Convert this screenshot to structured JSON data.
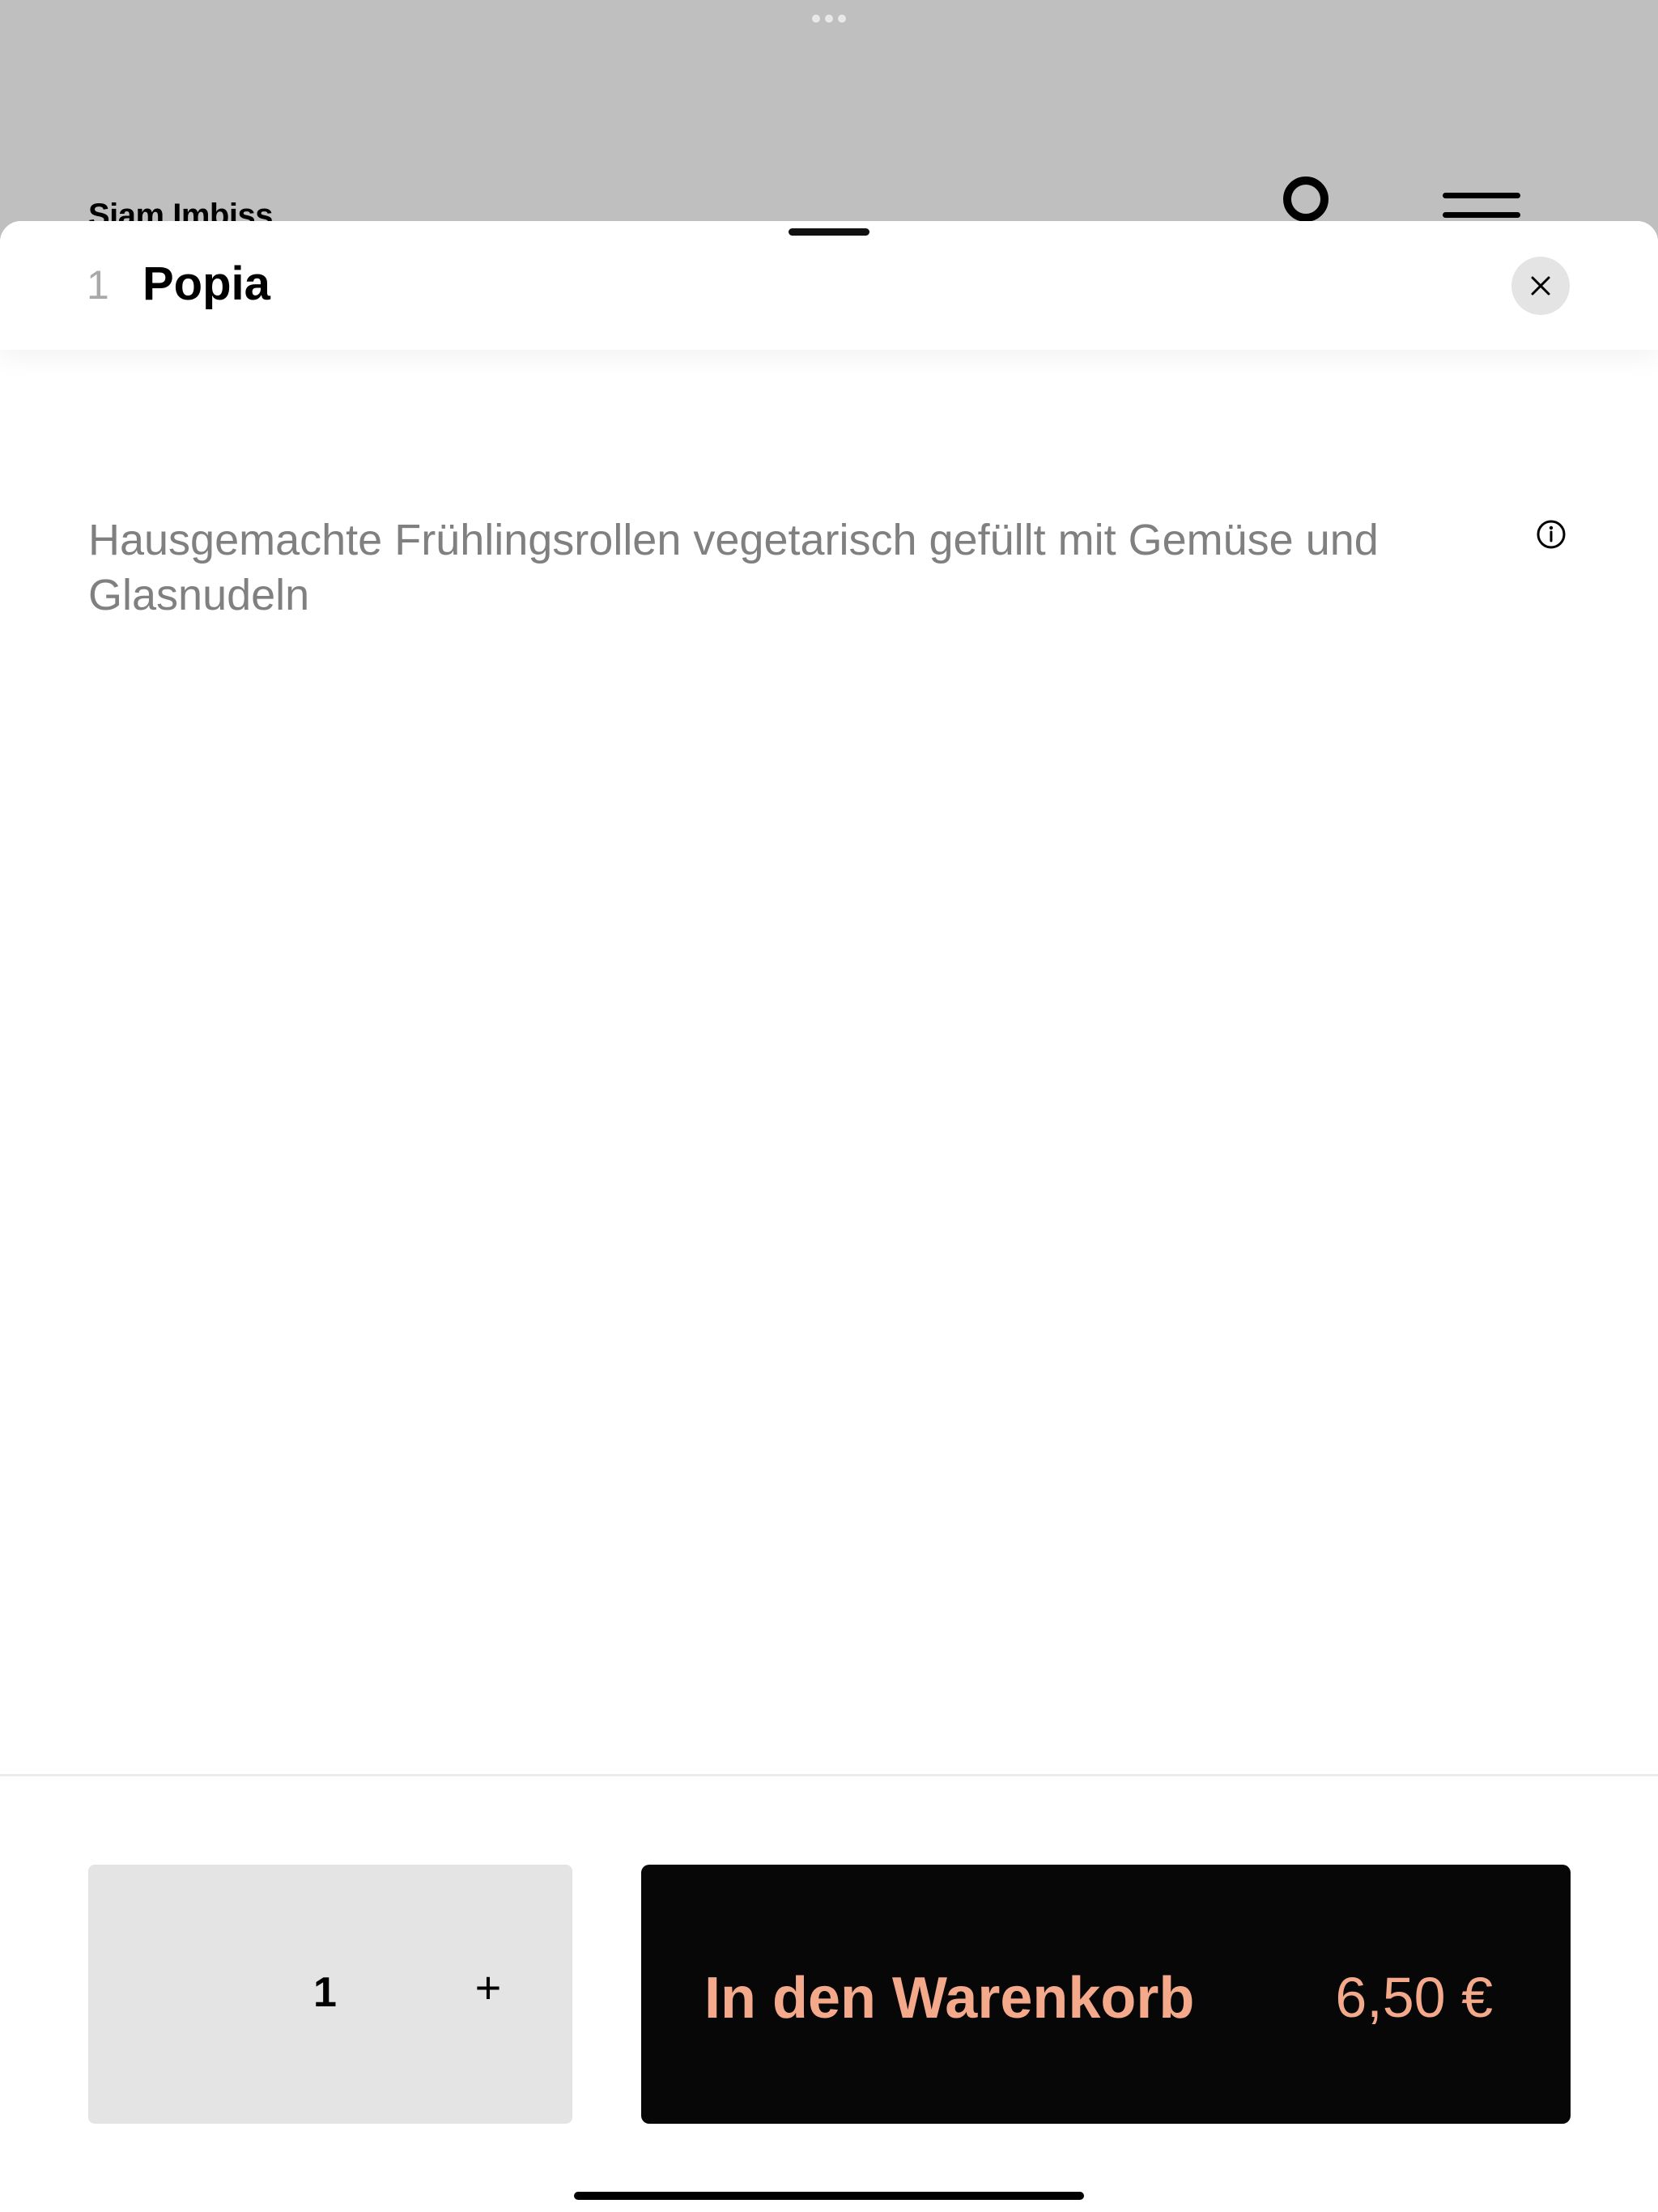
{
  "background_app": {
    "title": "Siam Imbiss",
    "profile_icon": "person-icon",
    "menu_icon": "menu-icon"
  },
  "sheet": {
    "item_number": "1",
    "item_title": "Popia",
    "close_icon": "close-icon",
    "description": "Hausgemachte Frühlingsrollen vegetarisch gefüllt mit Gemüse und Glasnudeln",
    "info_icon": "info-icon"
  },
  "footer": {
    "quantity": "1",
    "plus_label": "+",
    "add_to_cart_label": "In den Warenkorb",
    "price": "6,50 €"
  },
  "colors": {
    "accent": "#f4a98a",
    "button_bg": "#070707",
    "stepper_bg": "#e4e4e4",
    "description_text": "#808080"
  }
}
